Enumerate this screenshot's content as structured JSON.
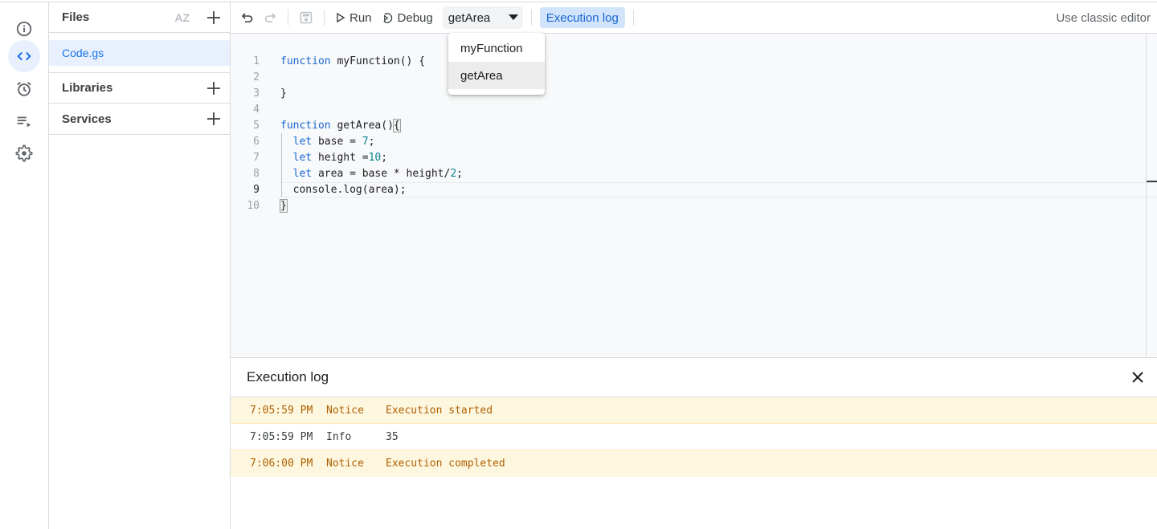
{
  "rail": {
    "items": [
      {
        "name": "overview",
        "icon": "info-icon",
        "active": false
      },
      {
        "name": "editor",
        "icon": "code-icon",
        "active": true
      },
      {
        "name": "triggers",
        "icon": "alarm-icon",
        "active": false
      },
      {
        "name": "executions",
        "icon": "executions-icon",
        "active": false
      },
      {
        "name": "settings",
        "icon": "gear-icon",
        "active": false
      }
    ]
  },
  "files": {
    "title": "Files",
    "sort_label": "AZ",
    "items": [
      {
        "label": "Code.gs",
        "selected": true
      }
    ],
    "sections": [
      {
        "label": "Libraries"
      },
      {
        "label": "Services"
      }
    ]
  },
  "toolbar": {
    "run_label": "Run",
    "debug_label": "Debug",
    "selected_function": "getArea",
    "exec_log_label": "Execution log",
    "classic_label": "Use classic editor"
  },
  "dropdown": {
    "options": [
      {
        "label": "myFunction",
        "hovered": false
      },
      {
        "label": "getArea",
        "hovered": true
      }
    ]
  },
  "editor": {
    "current_line": 9,
    "lines": [
      {
        "n": "1",
        "code": "function myFunction() {"
      },
      {
        "n": "2",
        "code": ""
      },
      {
        "n": "3",
        "code": "}"
      },
      {
        "n": "4",
        "code": ""
      },
      {
        "n": "5",
        "code": "function getArea(){"
      },
      {
        "n": "6",
        "code": "  let base = 7;"
      },
      {
        "n": "7",
        "code": "  let height =10;"
      },
      {
        "n": "8",
        "code": "  let area = base * height/2;"
      },
      {
        "n": "9",
        "code": "  console.log(area);"
      },
      {
        "n": "10",
        "code": "}"
      }
    ]
  },
  "log": {
    "title": "Execution log",
    "rows": [
      {
        "time": "7:05:59 PM",
        "severity": "Notice",
        "message": "Execution started"
      },
      {
        "time": "7:05:59 PM",
        "severity": "Info",
        "message": "35"
      },
      {
        "time": "7:06:00 PM",
        "severity": "Notice",
        "message": "Execution completed"
      }
    ]
  }
}
